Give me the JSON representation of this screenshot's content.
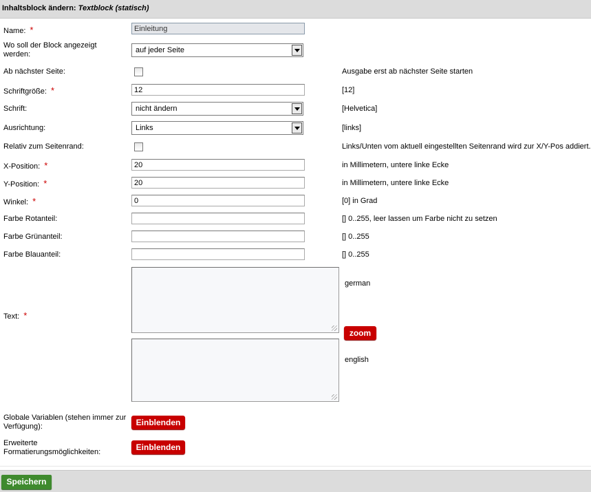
{
  "header": {
    "title_prefix": "Inhaltsblock ändern:",
    "title_type": "Textblock (statisch)"
  },
  "required_marker": "*",
  "fields": {
    "name": {
      "label": "Name:",
      "value": "Einleitung"
    },
    "display": {
      "label": "Wo soll der Block angezeigt werden:",
      "value": "auf jeder Seite"
    },
    "from_next_page": {
      "label": "Ab nächster Seite:",
      "hint": "Ausgabe erst ab nächster Seite starten"
    },
    "font_size": {
      "label": "Schriftgröße:",
      "value": "12",
      "hint": "[12]"
    },
    "font": {
      "label": "Schrift:",
      "value": "nicht ändern",
      "hint": "[Helvetica]"
    },
    "align": {
      "label": "Ausrichtung:",
      "value": "Links",
      "hint": "[links]"
    },
    "relative_margin": {
      "label": "Relativ zum Seitenrand:",
      "hint": "Links/Unten vom aktuell eingestellten Seitenrand wird zur X/Y-Pos addiert."
    },
    "x_pos": {
      "label": "X-Position:",
      "value": "20",
      "hint": "in Millimetern, untere linke Ecke"
    },
    "y_pos": {
      "label": "Y-Position:",
      "value": "20",
      "hint": "in Millimetern, untere linke Ecke"
    },
    "angle": {
      "label": "Winkel:",
      "value": "0",
      "hint": "[0] in Grad"
    },
    "red": {
      "label": "Farbe Rotanteil:",
      "value": "",
      "hint": "[] 0..255, leer lassen um Farbe nicht zu setzen"
    },
    "green": {
      "label": "Farbe Grünanteil:",
      "value": "",
      "hint": "[] 0..255"
    },
    "blue": {
      "label": "Farbe Blauanteil:",
      "value": "",
      "hint": "[] 0..255"
    },
    "text": {
      "label": "Text:",
      "lang_de": "german",
      "lang_en": "english",
      "zoom_label": "zoom"
    }
  },
  "globals": {
    "label": "Globale Variablen (stehen immer zur Verfügung):",
    "button": "Einblenden"
  },
  "formatting": {
    "label": "Erweiterte Formatierungsmöglichkeiten:",
    "button": "Einblenden"
  },
  "footer": {
    "save_label": "Speichern"
  },
  "colors": {
    "button_red": "#c80000",
    "button_green": "#3f8a2e",
    "header_bg": "#dcdcdc",
    "required": "#cc0000"
  }
}
